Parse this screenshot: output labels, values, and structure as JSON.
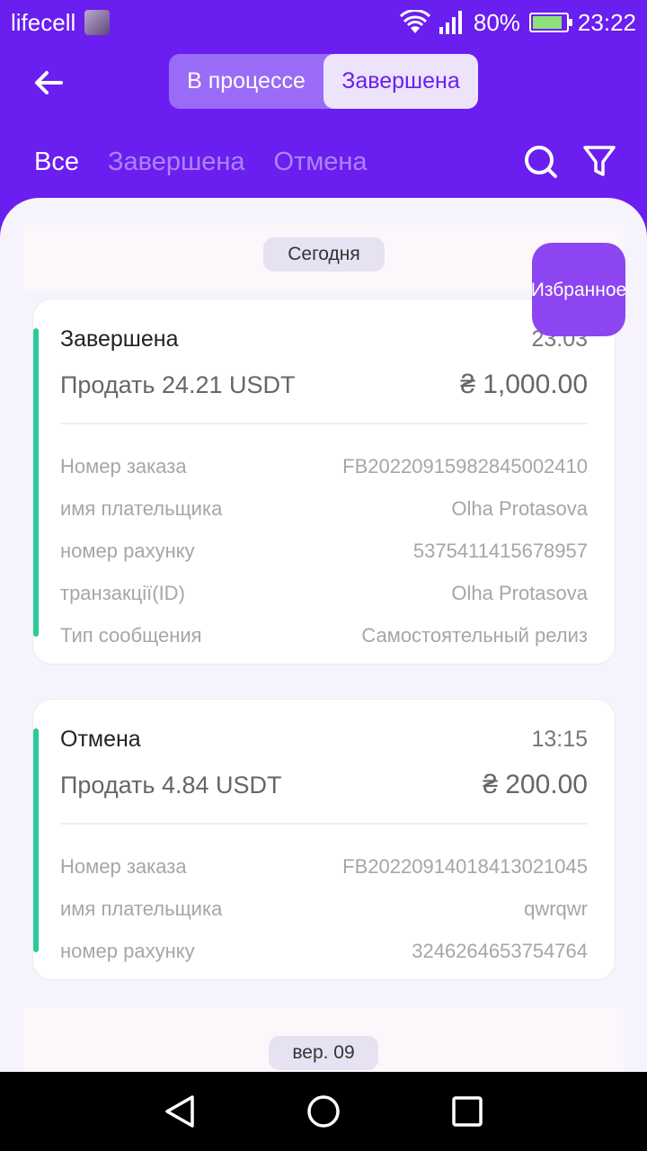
{
  "status_bar": {
    "carrier": "lifecell",
    "battery": "80%",
    "time": "23:22"
  },
  "header": {
    "segments": [
      "В процессе",
      "Завершена"
    ],
    "selected_segment": "Завершена",
    "filter_tabs": [
      "Все",
      "Завершена",
      "Отмена"
    ],
    "active_filter": "Все"
  },
  "favorites_label": "Избранное",
  "groups": [
    {
      "date_label": "Сегодня",
      "orders": [
        {
          "status": "Завершена",
          "time": "23:03",
          "title": "Продать 24.21 USDT",
          "amount": "₴ 1,000.00",
          "details": [
            {
              "label": "Номер заказа",
              "value": "FB20220915982845002410"
            },
            {
              "label": "имя плательщика",
              "value": "Olha Protasova"
            },
            {
              "label": "номер рахунку",
              "value": "5375411415678957"
            },
            {
              "label": "транзакції(ID)",
              "value": "Olha Protasova"
            },
            {
              "label": "Тип сообщения",
              "value": "Самостоятельный релиз"
            }
          ]
        },
        {
          "status": "Отмена",
          "time": "13:15",
          "title": "Продать 4.84 USDT",
          "amount": "₴ 200.00",
          "details": [
            {
              "label": "Номер заказа",
              "value": "FB20220914018413021045"
            },
            {
              "label": "имя плательщика",
              "value": "qwrqwr"
            },
            {
              "label": "номер рахунку",
              "value": "3246264653754764"
            }
          ]
        }
      ]
    },
    {
      "date_label": "вер. 09",
      "orders": []
    }
  ],
  "colors": {
    "brand": "#6a1ef0",
    "accent_bar": "#2ec99a",
    "favorites_button": "#8d45f2"
  }
}
